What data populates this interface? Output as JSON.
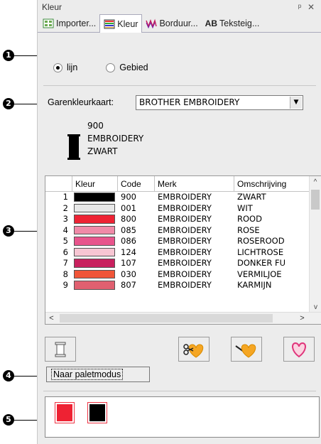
{
  "window": {
    "title": "Kleur",
    "pin_label": "ᵖ",
    "close_label": "✕"
  },
  "tabs": [
    {
      "label": "Importer...",
      "icon": "import-icon"
    },
    {
      "label": "Kleur",
      "icon": "color-icon"
    },
    {
      "label": "Borduur...",
      "icon": "embroidery-icon"
    },
    {
      "label": "Teksteig...",
      "icon": "text-ab-icon",
      "icon_text": "AB"
    }
  ],
  "callouts": [
    "1",
    "2",
    "3",
    "4",
    "5"
  ],
  "mode": {
    "options": [
      {
        "label": "lijn",
        "checked": true
      },
      {
        "label": "Gebied",
        "checked": false
      }
    ]
  },
  "thread_chart": {
    "label": "Garenkleurkaart:",
    "value": "BROTHER EMBROIDERY"
  },
  "current_thread": {
    "code": "900",
    "brand": "EMBROIDERY",
    "name": "ZWART",
    "color": "#000000"
  },
  "table": {
    "columns": [
      "",
      "Kleur",
      "Code",
      "Merk",
      "Omschrijving"
    ],
    "rows": [
      {
        "num": "1",
        "color": "#000000",
        "code": "900",
        "brand": "EMBROIDERY",
        "desc": "ZWART"
      },
      {
        "num": "2",
        "color": "#e8e8e8",
        "code": "001",
        "brand": "EMBROIDERY",
        "desc": "WIT"
      },
      {
        "num": "3",
        "color": "#ee2233",
        "code": "800",
        "brand": "EMBROIDERY",
        "desc": "ROOD"
      },
      {
        "num": "4",
        "color": "#f08aa8",
        "code": "085",
        "brand": "EMBROIDERY",
        "desc": "ROSE"
      },
      {
        "num": "5",
        "color": "#e8548c",
        "code": "086",
        "brand": "EMBROIDERY",
        "desc": "ROSEROOD"
      },
      {
        "num": "6",
        "color": "#f7c6d3",
        "code": "124",
        "brand": "EMBROIDERY",
        "desc": "LICHTROSE"
      },
      {
        "num": "7",
        "color": "#c8205e",
        "code": "107",
        "brand": "EMBROIDERY",
        "desc": "DONKER FU"
      },
      {
        "num": "8",
        "color": "#f05538",
        "code": "030",
        "brand": "EMBROIDERY",
        "desc": "VERMILJOE"
      },
      {
        "num": "9",
        "color": "#e06070",
        "code": "807",
        "brand": "EMBROIDERY",
        "desc": "KARMIJN"
      }
    ],
    "scroll_up": "^",
    "scroll_down": "v",
    "scroll_left": "<",
    "scroll_right": ">"
  },
  "buttons": {
    "palette_mode": "Naar paletmodus"
  },
  "palette": [
    {
      "color": "#ee2233"
    },
    {
      "color": "#000000"
    }
  ]
}
